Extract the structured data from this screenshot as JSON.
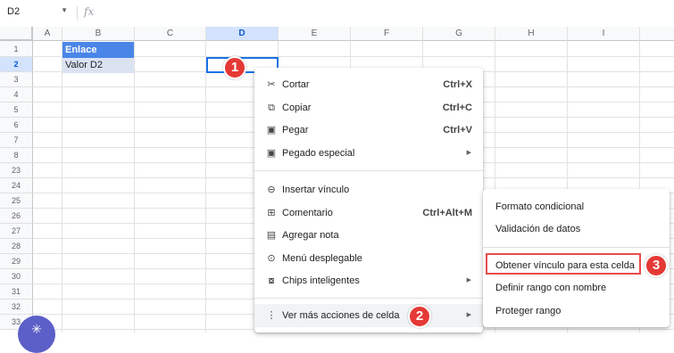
{
  "name_box": {
    "value": "D2"
  },
  "formula_bar": {
    "fx_label": "fx"
  },
  "columns": [
    {
      "label": "A"
    },
    {
      "label": "B"
    },
    {
      "label": "C"
    },
    {
      "label": "D"
    },
    {
      "label": "E"
    },
    {
      "label": "F"
    },
    {
      "label": "G"
    },
    {
      "label": "H"
    },
    {
      "label": "I"
    }
  ],
  "rows": [
    "1",
    "2",
    "3",
    "4",
    "5",
    "6",
    "7",
    "8",
    "23",
    "24",
    "25",
    "26",
    "27",
    "28",
    "29",
    "30",
    "31",
    "32",
    "33"
  ],
  "cells": {
    "B1": "Enlace",
    "B2": "Valor D2"
  },
  "context_menu": {
    "items": [
      {
        "label": "Cortar",
        "shortcut": "Ctrl+X",
        "icon": "scissors-icon"
      },
      {
        "label": "Copiar",
        "shortcut": "Ctrl+C",
        "icon": "copy-icon"
      },
      {
        "label": "Pegar",
        "shortcut": "Ctrl+V",
        "icon": "clipboard-icon"
      },
      {
        "label": "Pegado especial",
        "icon": "clipboard-icon"
      },
      {
        "label": "Insertar vínculo",
        "icon": "link-icon"
      },
      {
        "label": "Comentario",
        "shortcut": "Ctrl+Alt+M",
        "icon": "comment-icon"
      },
      {
        "label": "Agregar nota",
        "icon": "note-icon"
      },
      {
        "label": "Menú desplegable",
        "icon": "dropdown-icon"
      },
      {
        "label": "Chips inteligentes",
        "icon": "chips-icon"
      },
      {
        "label": "Ver más acciones de celda",
        "icon": "more-vert-icon"
      }
    ]
  },
  "submenu": {
    "items": [
      {
        "label": "Formato condicional"
      },
      {
        "label": "Validación de datos"
      },
      {
        "label": "Obtener vínculo para esta celda"
      },
      {
        "label": "Definir rango con nombre"
      },
      {
        "label": "Proteger rango"
      }
    ]
  },
  "badges": [
    "1",
    "2",
    "3"
  ],
  "colors": {
    "accent": "#1a73e8",
    "header_fill": "#4a86e8",
    "badge": "#e53935",
    "highlight_box": "#e94b4b"
  }
}
